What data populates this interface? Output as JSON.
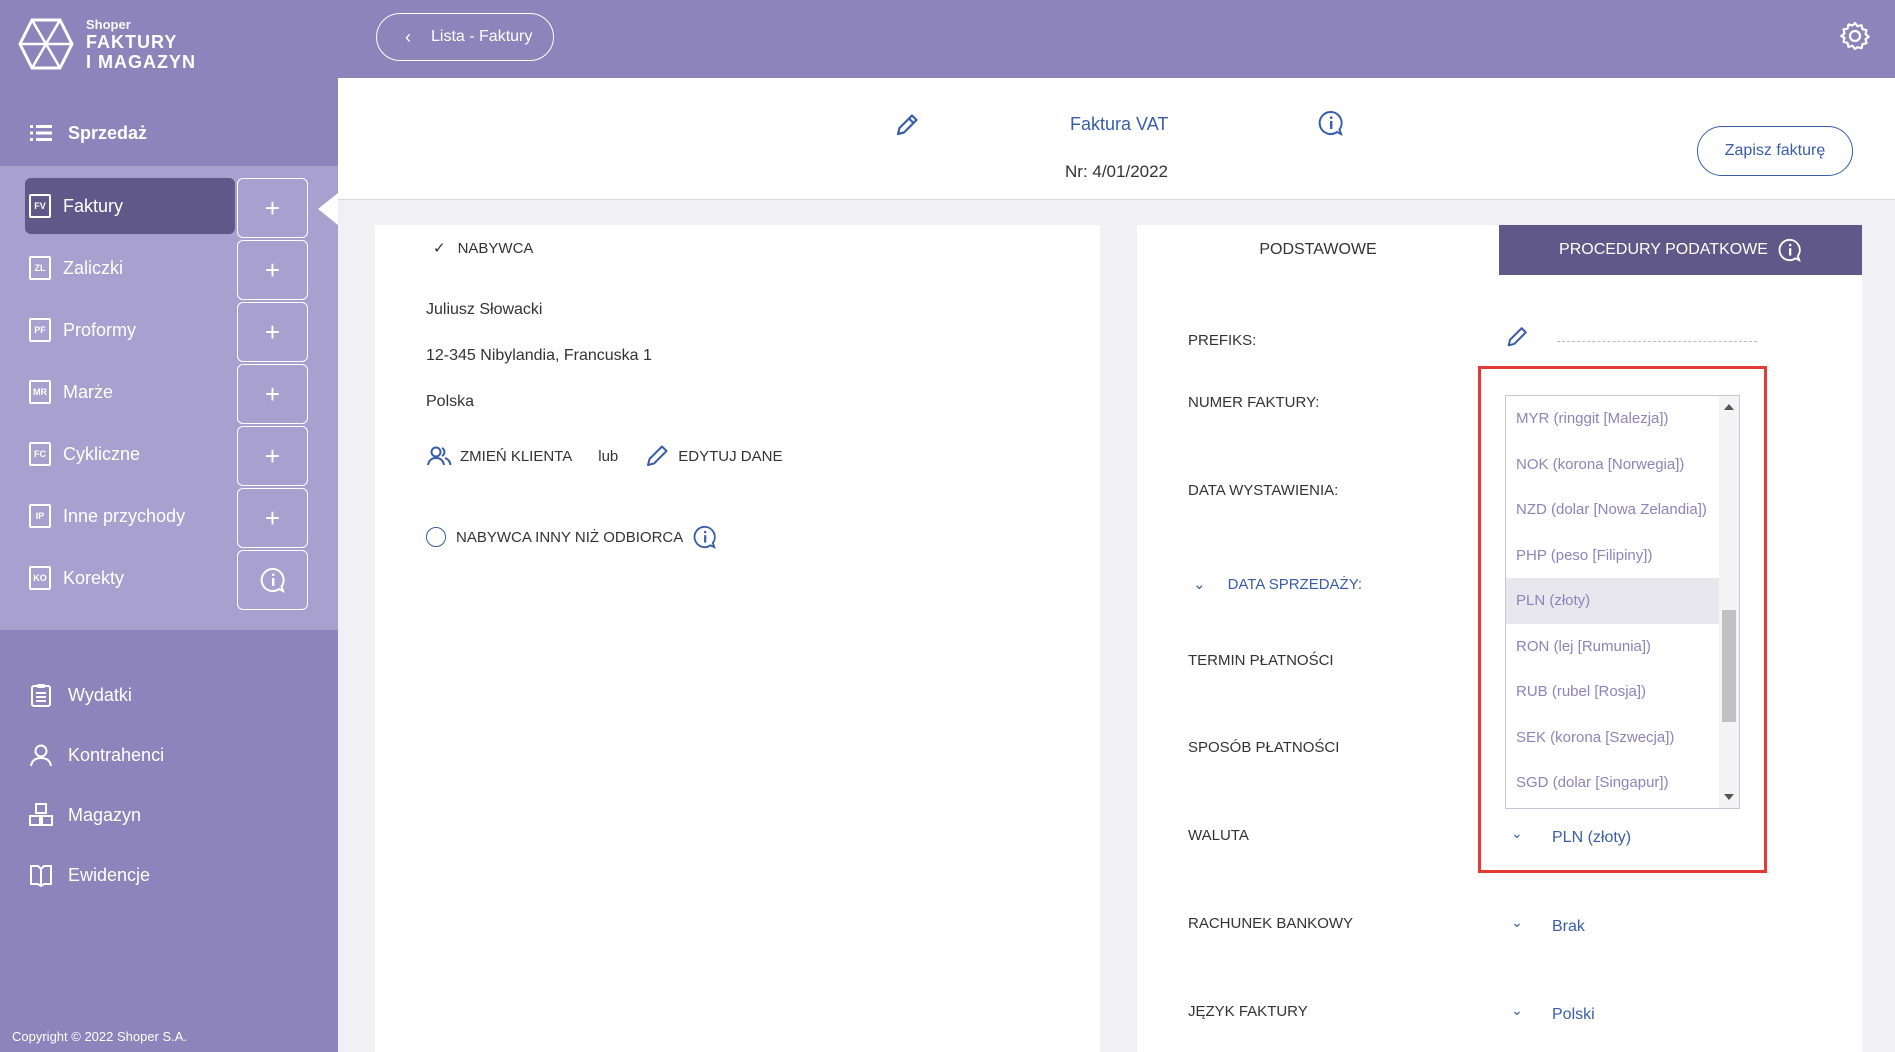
{
  "brand": {
    "small": "Shoper",
    "line1": "FAKTURY",
    "line2": "I MAGAZYN"
  },
  "sidebar": {
    "section_title": "Sprzedaż",
    "sales_items": [
      {
        "label": "Faktury",
        "badge": "FV",
        "action": "+"
      },
      {
        "label": "Zaliczki",
        "badge": "ZL",
        "action": "+"
      },
      {
        "label": "Proformy",
        "badge": "PF",
        "action": "+"
      },
      {
        "label": "Marże",
        "badge": "MR",
        "action": "+"
      },
      {
        "label": "Cykliczne",
        "badge": "FC",
        "action": "+"
      },
      {
        "label": "Inne przychody",
        "badge": "IP",
        "action": "+"
      },
      {
        "label": "Korekty",
        "badge": "KO",
        "action": "info"
      }
    ],
    "main_items": [
      {
        "label": "Wydatki",
        "icon": "clipboard-icon"
      },
      {
        "label": "Kontrahenci",
        "icon": "user-icon"
      },
      {
        "label": "Magazyn",
        "icon": "boxes-icon"
      },
      {
        "label": "Ewidencje",
        "icon": "book-icon"
      }
    ],
    "copyright": "Copyright © 2022 Shoper S.A."
  },
  "topbar": {
    "back_label": "Lista - Faktury"
  },
  "header": {
    "title": "Faktura VAT",
    "number": "Nr: 4/01/2022",
    "save_label": "Zapisz fakturę"
  },
  "buyer": {
    "heading": "NABYWCA",
    "name": "Juliusz Słowacki",
    "address": "12-345 Nibylandia, Francuska 1",
    "country": "Polska",
    "change_client": "ZMIEŃ KLIENTA",
    "or": "lub",
    "edit_data": "EDYTUJ DANE",
    "other_recipient": "NABYWCA INNY NIŻ ODBIORCA"
  },
  "tabs": {
    "basic": "PODSTAWOWE",
    "procedures": "PROCEDURY PODATKOWE"
  },
  "fields": {
    "prefix": "PREFIKS:",
    "invoice_number": "NUMER FAKTURY:",
    "issue_date": "DATA WYSTAWIENIA:",
    "sale_date": "DATA SPRZEDAŻY:",
    "payment_term": "TERMIN PŁATNOŚCI",
    "payment_method": "SPOSÓB PŁATNOŚCI",
    "currency": "WALUTA",
    "currency_value": "PLN (złoty)",
    "bank_account": "RACHUNEK BANKOWY",
    "bank_account_value": "Brak",
    "language": "JĘZYK FAKTURY",
    "language_value": "Polski"
  },
  "currency_options": [
    "MYR (ringgit [Malezja])",
    "NOK (korona [Norwegia])",
    "NZD (dolar [Nowa Zelandia])",
    "PHP (peso [Filipiny])",
    "PLN (złoty)",
    "RON (lej [Rumunia])",
    "RUB (rubel [Rosja])",
    "SEK (korona [Szwecja])",
    "SGD (dolar [Singapur])"
  ],
  "currency_selected_index": 4,
  "colors": {
    "sidebar": "#8c84ba",
    "sidebar_light": "#a8a1cf",
    "active": "#5f5889",
    "accent": "#3a5da8",
    "highlight": "#e53935"
  }
}
